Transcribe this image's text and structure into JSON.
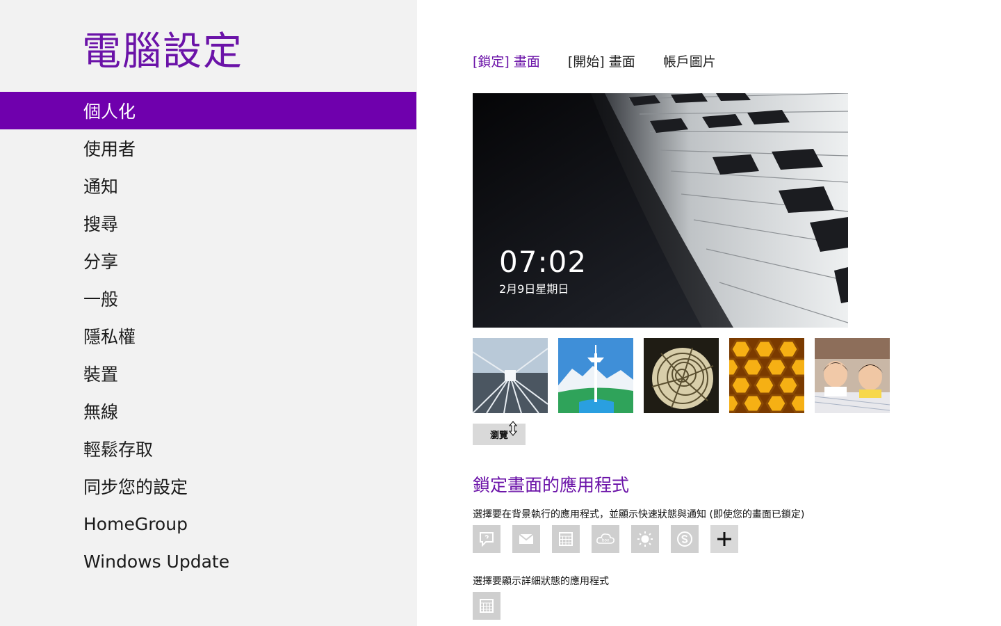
{
  "sidebar": {
    "title": "電腦設定",
    "items": [
      {
        "label": "個人化",
        "selected": true
      },
      {
        "label": "使用者",
        "selected": false
      },
      {
        "label": "通知",
        "selected": false
      },
      {
        "label": "搜尋",
        "selected": false
      },
      {
        "label": "分享",
        "selected": false
      },
      {
        "label": "一般",
        "selected": false
      },
      {
        "label": "隱私權",
        "selected": false
      },
      {
        "label": "裝置",
        "selected": false
      },
      {
        "label": "無線",
        "selected": false
      },
      {
        "label": "輕鬆存取",
        "selected": false
      },
      {
        "label": "同步您的設定",
        "selected": false
      },
      {
        "label": "HomeGroup",
        "selected": false
      },
      {
        "label": "Windows Update",
        "selected": false
      }
    ]
  },
  "tabs": [
    {
      "label": "[鎖定] 畫面",
      "active": true
    },
    {
      "label": "[開始] 畫面",
      "active": false
    },
    {
      "label": "帳戶圖片",
      "active": false
    }
  ],
  "preview": {
    "time": "07:02",
    "date": "2月9日星期日"
  },
  "thumbnails": [
    {
      "icon": "motion-tunnel-image"
    },
    {
      "icon": "space-needle-image"
    },
    {
      "icon": "nautilus-shell-image"
    },
    {
      "icon": "honeycomb-image"
    },
    {
      "icon": "children-photo-image"
    }
  ],
  "browse_label": "瀏覽",
  "lock_apps": {
    "title": "鎖定畫面的應用程式",
    "quick_status_desc": "選擇要在背景執行的應用程式，並顯示快速狀態與通知 (即使您的畫面已鎖定)",
    "quick_apps": [
      {
        "icon": "messaging-icon"
      },
      {
        "icon": "mail-icon"
      },
      {
        "icon": "calendar-icon"
      },
      {
        "icon": "box-cloud-icon"
      },
      {
        "icon": "weather-sun-icon"
      },
      {
        "icon": "skype-icon"
      },
      {
        "icon": "add-icon"
      }
    ],
    "detail_desc": "選擇要顯示詳細狀態的應用程式",
    "detail_app": {
      "icon": "calendar-icon"
    }
  },
  "colors": {
    "accent": "#6b13a8",
    "selected_bg": "#6f00ad",
    "sidebar_bg": "#f2f2f2",
    "slot_bg": "#cfcfcf"
  }
}
